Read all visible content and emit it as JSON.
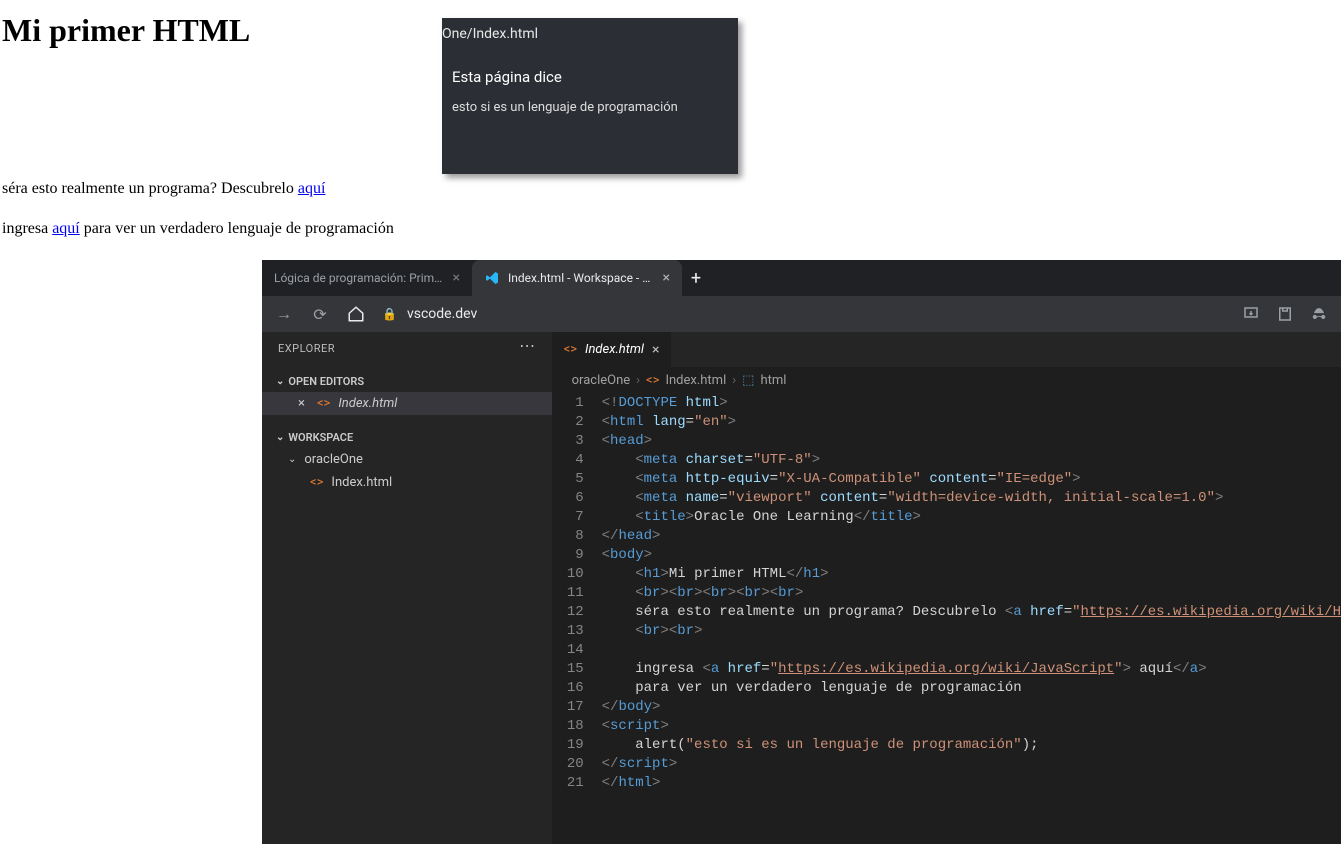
{
  "rendered_page": {
    "h1": "Mi primer HTML",
    "p1_text": "séra esto realmente un programa? Descubrelo ",
    "p1_link": "aquí",
    "p2_prefix": "ingresa ",
    "p2_link": "aquí",
    "p2_suffix": " para ver un verdadero lenguaje de programación"
  },
  "alert": {
    "url": "One/Index.html",
    "title": "Esta página dice",
    "message": "esto si es un lenguaje de programación"
  },
  "browser": {
    "tabs": [
      {
        "label": "Lógica de programación: Primer",
        "active": false
      },
      {
        "label": "Index.html - Workspace - Visual",
        "active": true
      }
    ],
    "url": "vscode.dev"
  },
  "vscode": {
    "sidebar": {
      "title": "EXPLORER",
      "openEditors": "OPEN EDITORS",
      "openFile": "Index.html",
      "workspace": "WORKSPACE",
      "folder": "oracleOne",
      "file": "Index.html"
    },
    "tab": "Index.html",
    "breadcrumb": {
      "a": "oracleOne",
      "b": "Index.html",
      "c": "html"
    },
    "code": [
      {
        "n": 1,
        "html": "<span class='t-gray'>&lt;!</span><span class='t-blue'>DOCTYPE</span> <span class='t-attr'>html</span><span class='t-gray'>&gt;</span>"
      },
      {
        "n": 2,
        "html": "<span class='t-gray'>&lt;</span><span class='t-blue'>html</span> <span class='t-attr'>lang</span><span class='t-white'>=</span><span class='t-str'>\"en\"</span><span class='t-gray'>&gt;</span>"
      },
      {
        "n": 3,
        "html": "<span class='t-gray'>&lt;</span><span class='t-blue'>head</span><span class='t-gray'>&gt;</span>"
      },
      {
        "n": 4,
        "html": "    <span class='t-gray'>&lt;</span><span class='t-blue'>meta</span> <span class='t-attr'>charset</span><span class='t-white'>=</span><span class='t-str'>\"UTF-8\"</span><span class='t-gray'>&gt;</span>"
      },
      {
        "n": 5,
        "html": "    <span class='t-gray'>&lt;</span><span class='t-blue'>meta</span> <span class='t-attr'>http-equiv</span><span class='t-white'>=</span><span class='t-str'>\"X-UA-Compatible\"</span> <span class='t-attr'>content</span><span class='t-white'>=</span><span class='t-str'>\"IE=edge\"</span><span class='t-gray'>&gt;</span>"
      },
      {
        "n": 6,
        "html": "    <span class='t-gray'>&lt;</span><span class='t-blue'>meta</span> <span class='t-attr'>name</span><span class='t-white'>=</span><span class='t-str'>\"viewport\"</span> <span class='t-attr'>content</span><span class='t-white'>=</span><span class='t-str'>\"width=device-width, initial-scale=1.0\"</span><span class='t-gray'>&gt;</span>"
      },
      {
        "n": 7,
        "html": "    <span class='t-gray'>&lt;</span><span class='t-blue'>title</span><span class='t-gray'>&gt;</span><span class='t-white'>Oracle One Learning</span><span class='t-gray'>&lt;/</span><span class='t-blue'>title</span><span class='t-gray'>&gt;</span>"
      },
      {
        "n": 8,
        "html": "<span class='t-gray'>&lt;/</span><span class='t-blue'>head</span><span class='t-gray'>&gt;</span>"
      },
      {
        "n": 9,
        "html": "<span class='t-gray'>&lt;</span><span class='t-blue'>body</span><span class='t-gray'>&gt;</span>"
      },
      {
        "n": 10,
        "html": "    <span class='t-gray'>&lt;</span><span class='t-blue'>h1</span><span class='t-gray'>&gt;</span><span class='t-white'>Mi primer HTML</span><span class='t-gray'>&lt;/</span><span class='t-blue'>h1</span><span class='t-gray'>&gt;</span>"
      },
      {
        "n": 11,
        "html": "    <span class='t-gray'>&lt;</span><span class='t-blue'>br</span><span class='t-gray'>&gt;&lt;</span><span class='t-blue'>br</span><span class='t-gray'>&gt;&lt;</span><span class='t-blue'>br</span><span class='t-gray'>&gt;&lt;</span><span class='t-blue'>br</span><span class='t-gray'>&gt;&lt;</span><span class='t-blue'>br</span><span class='t-gray'>&gt;</span>"
      },
      {
        "n": 12,
        "html": "    <span class='t-white'>séra esto realmente un programa? Descubrelo </span><span class='t-gray'>&lt;</span><span class='t-blue'>a</span> <span class='t-attr'>href</span><span class='t-white'>=</span><span class='t-str'>\"</span><span class='t-link'>https://es.wikipedia.org/wiki/H</span>"
      },
      {
        "n": 13,
        "html": "    <span class='t-gray'>&lt;</span><span class='t-blue'>br</span><span class='t-gray'>&gt;&lt;</span><span class='t-blue'>br</span><span class='t-gray'>&gt;</span>"
      },
      {
        "n": 14,
        "html": ""
      },
      {
        "n": 15,
        "html": "    <span class='t-white'>ingresa </span><span class='t-gray'>&lt;</span><span class='t-blue'>a</span> <span class='t-attr'>href</span><span class='t-white'>=</span><span class='t-str'>\"</span><span class='t-link'>https://es.wikipedia.org/wiki/JavaScript</span><span class='t-str'>\"</span><span class='t-gray'>&gt;</span><span class='t-white'> aquí</span><span class='t-gray'>&lt;/</span><span class='t-blue'>a</span><span class='t-gray'>&gt;</span>"
      },
      {
        "n": 16,
        "html": "    <span class='t-white'>para ver un verdadero lenguaje de programación</span>"
      },
      {
        "n": 17,
        "html": "<span class='t-gray'>&lt;/</span><span class='t-blue'>body</span><span class='t-gray'>&gt;</span>"
      },
      {
        "n": 18,
        "html": "<span class='t-gray'>&lt;</span><span class='t-blue'>script</span><span class='t-gray'>&gt;</span>"
      },
      {
        "n": 19,
        "html": "    <span class='t-white'>alert(</span><span class='t-str'>\"esto si es un lenguaje de programación\"</span><span class='t-white'>);</span>"
      },
      {
        "n": 20,
        "html": "<span class='t-gray'>&lt;/</span><span class='t-blue'>script</span><span class='t-gray'>&gt;</span>"
      },
      {
        "n": 21,
        "html": "<span class='t-gray'>&lt;/</span><span class='t-blue'>html</span><span class='t-gray'>&gt;</span>"
      }
    ]
  }
}
